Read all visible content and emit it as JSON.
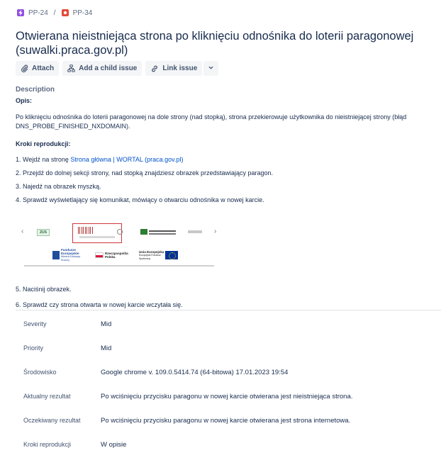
{
  "breadcrumb": {
    "parent": "PP-24",
    "separator": "/",
    "current": "PP-34"
  },
  "issue": {
    "title": "Otwierana nieistniejąca strona po kliknięciu odnośnika do loterii paragonowej (suwalki.praca.gov.pl)"
  },
  "actions": {
    "attach": "Attach",
    "add_child": "Add a child issue",
    "link_issue": "Link issue"
  },
  "description": {
    "heading": "Description",
    "opis_label": "Opis:",
    "opis_text": "Po kliknięciu odnośnika do loterii paragonowej na dole strony (nad stopką), strona przekierowuje użytkownika do nieistniejącej strony (błąd DNS_PROBE_FINISHED_NXDOMAIN).",
    "kroki_label": "Kroki reprodukcji:",
    "step1_prefix": "1. Wejdź na stronę ",
    "step1_link": "Strona główna | WORTAL (praca.gov.pl)",
    "step2": "2. Przejdź do dolnej sekcji strony, nad stopką znajdziesz obrazek przedstawiający paragon.",
    "step3": "3. Najedź na obrazek myszką.",
    "step4": "4. Sprawdź wyświetlający się komunikat, mówiący o otwarciu odnośnika w nowej karcie.",
    "step5": "5. Naciśnij obrazek.",
    "step6": "6. Sprawdź czy strona otwarta w nowej karcie wczytała się."
  },
  "screenshot": {
    "prev_arrow": "‹",
    "next_arrow": "›",
    "zus_logo": "ZUS",
    "fundusze": "Fundusze Europejskie",
    "fundusze_sub": "Wiedza Edukacja Rozwój",
    "rp": "Rzeczpospolita Polska",
    "ue": "Unia Europejska",
    "ue_sub": "Europejski Fundusz Społeczny"
  },
  "fields": [
    {
      "label": "Severity",
      "value": "Mid"
    },
    {
      "label": "Priority",
      "value": "Mid"
    },
    {
      "label": "Środowisko",
      "value": "Google chrome v. 109.0.5414.74 (64-bitowa) 17.01.2023 19:54"
    },
    {
      "label": "Aktualny rezultat",
      "value": "Po wciśnięciu przycisku paragonu w nowej karcie otwierana jest nieistniejąca strona."
    },
    {
      "label": "Oczekiwany rezultat",
      "value": "Po wciśnięciu przycisku paragonu w nowej karcie otwierana jest strona internetowa."
    },
    {
      "label": "Kroki reprodukcji",
      "value": "W opisie"
    }
  ],
  "colors": {
    "epic": "#904ee2",
    "bug": "#e5493a",
    "link": "#0052cc",
    "text": "#172b4d"
  }
}
